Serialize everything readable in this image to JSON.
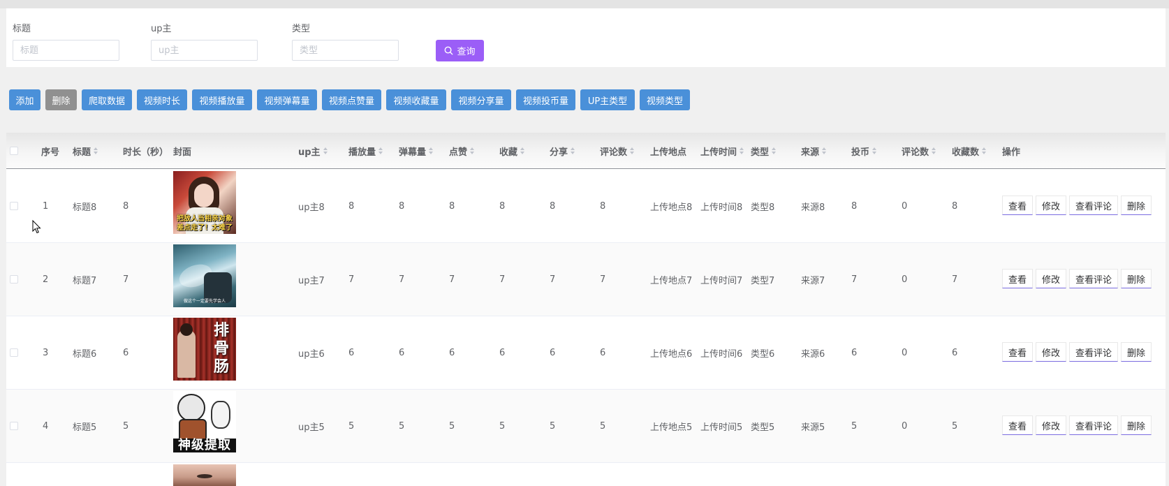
{
  "search": {
    "fields": [
      {
        "label": "标题",
        "placeholder": "标题"
      },
      {
        "label": "up主",
        "placeholder": "up主"
      },
      {
        "label": "类型",
        "placeholder": "类型"
      }
    ],
    "query_label": "查询"
  },
  "toolbar": {
    "buttons": [
      "添加",
      "删除",
      "爬取数据",
      "视频时长",
      "视频播放量",
      "视频弹幕量",
      "视频点赞量",
      "视频收藏量",
      "视频分享量",
      "视频投币量",
      "UP主类型",
      "视频类型"
    ]
  },
  "colors": {
    "accent_purple": "#9b5ef7",
    "toolbar_blue": "#4a90d9",
    "delete_gray": "#909090"
  },
  "table": {
    "headers": [
      "序号",
      "标题",
      "时长（秒）",
      "封面",
      "up主",
      "播放量",
      "弹幕量",
      "点赞",
      "收藏",
      "分享",
      "评论数",
      "上传地点",
      "上传时间",
      "类型",
      "来源",
      "投币",
      "评论数",
      "收藏数",
      "操作"
    ],
    "rows": [
      {
        "index": "1",
        "title": "标题8",
        "duration": "8",
        "up": "up主8",
        "plays": "8",
        "danmaku": "8",
        "likes": "8",
        "favorites": "8",
        "shares": "8",
        "comments": "8",
        "location": "上传地点8",
        "upload_time": "上传时间8",
        "type": "类型8",
        "source": "来源8",
        "coins": "8",
        "comment_count": "0",
        "fav_count": "8",
        "cover_text": "把敌人当相亲对象 差点走了！太难了"
      },
      {
        "index": "2",
        "title": "标题7",
        "duration": "7",
        "up": "up主7",
        "plays": "7",
        "danmaku": "7",
        "likes": "7",
        "favorites": "7",
        "shares": "7",
        "comments": "7",
        "location": "上传地点7",
        "upload_time": "上传时间7",
        "type": "类型7",
        "source": "来源7",
        "coins": "7",
        "comment_count": "0",
        "fav_count": "7",
        "cover_text": "做这个一定要先学会人"
      },
      {
        "index": "3",
        "title": "标题6",
        "duration": "6",
        "up": "up主6",
        "plays": "6",
        "danmaku": "6",
        "likes": "6",
        "favorites": "6",
        "shares": "6",
        "comments": "6",
        "location": "上传地点6",
        "upload_time": "上传时间6",
        "type": "类型6",
        "source": "来源6",
        "coins": "6",
        "comment_count": "0",
        "fav_count": "6",
        "cover_text": "排骨肠"
      },
      {
        "index": "4",
        "title": "标题5",
        "duration": "5",
        "up": "up主5",
        "plays": "5",
        "danmaku": "5",
        "likes": "5",
        "favorites": "5",
        "shares": "5",
        "comments": "5",
        "location": "上传地点5",
        "upload_time": "上传时间5",
        "type": "类型5",
        "source": "来源5",
        "coins": "5",
        "comment_count": "0",
        "fav_count": "5",
        "cover_text": "神级提取"
      }
    ],
    "actions": [
      "查看",
      "修改",
      "查看评论",
      "删除"
    ]
  },
  "icons": {
    "query": "search-icon",
    "cursor": "mouse-pointer-icon"
  }
}
